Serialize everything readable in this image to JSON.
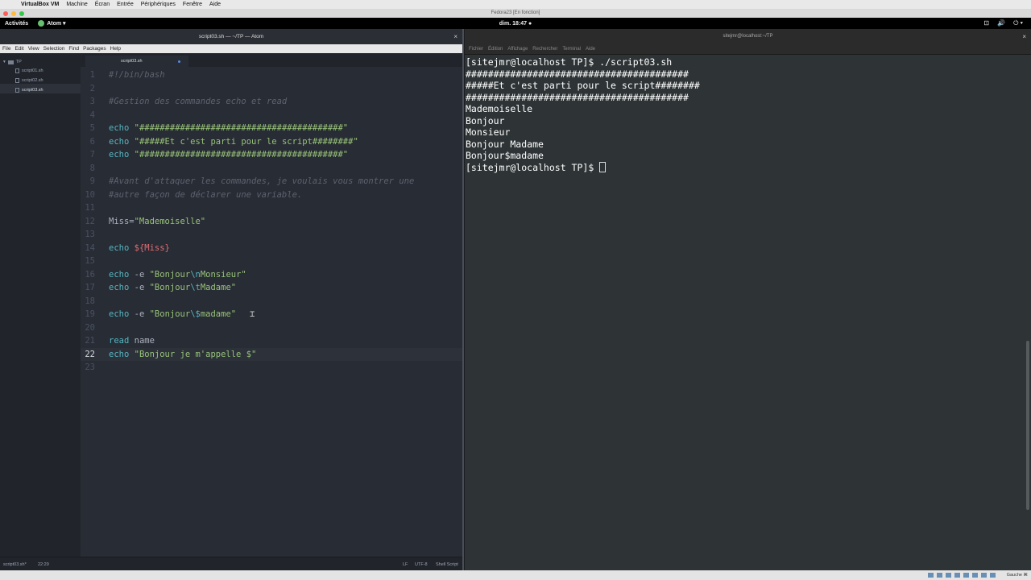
{
  "mac_menubar": {
    "app": "VirtualBox VM",
    "items": [
      "Machine",
      "Écran",
      "Entrée",
      "Périphériques",
      "Fenêtre",
      "Aide"
    ]
  },
  "vbox_title": "Fedora23 [En fonction]",
  "gnome": {
    "activities": "Activités",
    "app_menu": "Atom ▾",
    "clock": "dim. 18:47 ●",
    "tray": [
      "⊡",
      "🔊",
      "⏻ ▾"
    ]
  },
  "atom": {
    "title": "script03.sh — ~/TP — Atom",
    "menu": [
      "File",
      "Edit",
      "View",
      "Selection",
      "Find",
      "Packages",
      "Help"
    ],
    "tree": {
      "root": "TP",
      "files": [
        "script01.sh",
        "script02.sh",
        "script03.sh"
      ]
    },
    "tab": "script03.sh",
    "status": {
      "file": "script03.sh*",
      "pos": "22:29",
      "eol": "LF",
      "enc": "UTF-8",
      "grammar": "Shell Script"
    },
    "lines": {
      "n1": "1",
      "n2": "2",
      "n3": "3",
      "n4": "4",
      "n5": "5",
      "n6": "6",
      "n7": "7",
      "n8": "8",
      "n9": "9",
      "n10": "10",
      "n11": "11",
      "n12": "12",
      "n13": "13",
      "n14": "14",
      "n15": "15",
      "n16": "16",
      "n17": "17",
      "n18": "18",
      "n19": "19",
      "n20": "20",
      "n21": "21",
      "n22": "22",
      "n23": "23",
      "l1": "#!/bin/bash",
      "l3": "#Gestion des commandes echo et read",
      "l5_kw": "echo",
      "l5_str": "\"########################################\"",
      "l6_kw": "echo",
      "l6_str": "\"#####Et c'est parti pour le script########\"",
      "l7_kw": "echo",
      "l7_str": "\"########################################\"",
      "l9": "#Avant d'attaquer les commandes, je voulais vous montrer une",
      "l10": "#autre façon de déclarer une variable.",
      "l12_a": "Miss=",
      "l12_b": "\"Mademoiselle\"",
      "l14_kw": "echo",
      "l14_var": "${Miss}",
      "l16_kw": "echo",
      "l16_opt": "-e",
      "l16_s1": "\"Bonjour",
      "l16_esc": "\\n",
      "l16_s2": "Monsieur\"",
      "l17_kw": "echo",
      "l17_opt": "-e",
      "l17_s1": "\"Bonjour",
      "l17_esc": "\\t",
      "l17_s2": "Madame\"",
      "l19_kw": "echo",
      "l19_opt": "-e",
      "l19_s1": "\"Bonjour",
      "l19_esc": "\\$",
      "l19_s2": "madame\"",
      "l21_kw": "read",
      "l21_arg": "name",
      "l22_kw": "echo",
      "l22_str": "\"Bonjour je m'appelle $\""
    }
  },
  "terminal": {
    "title": "sitejmr@localhost:~/TP",
    "menu": [
      "Fichier",
      "Édition",
      "Affichage",
      "Rechercher",
      "Terminal",
      "Aide"
    ],
    "output": [
      "[sitejmr@localhost TP]$ ./script03.sh",
      "########################################",
      "#####Et c'est parti pour le script########",
      "########################################",
      "Mademoiselle",
      "Bonjour",
      "Monsieur",
      "Bonjour Madame",
      "Bonjour$madame"
    ],
    "prompt": "[sitejmr@localhost TP]$ "
  },
  "vbox_status": {
    "host_key": "Gauche ⌘"
  },
  "colors": {
    "atom_bg": "#282c34",
    "keyword": "#56b6c2",
    "string": "#98c379",
    "variable": "#e06c75",
    "comment": "#5c6370",
    "terminal_bg": "#2e3436"
  }
}
